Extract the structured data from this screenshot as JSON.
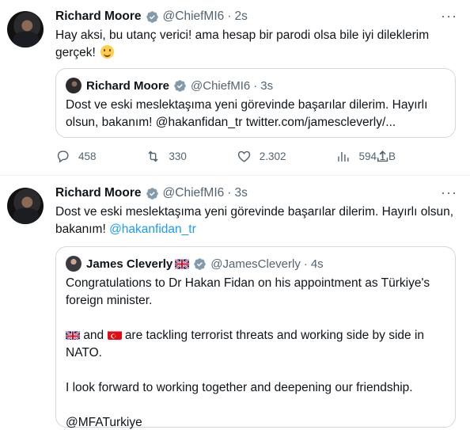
{
  "tweet1": {
    "author_name": "Richard Moore",
    "handle": "@ChiefMI6",
    "separator": "·",
    "time": "2s",
    "text": "Hay aksi, bu utanç verici! ama hesap bir parodi olsa bile iyi dileklerim gerçek!",
    "emoji_icon": "smiling-face-icon",
    "quote": {
      "author_name": "Richard Moore",
      "handle": "@ChiefMI6",
      "separator": "·",
      "time": "3s",
      "text": "Dost ve eski meslektaşıma yeni görevinde başarılar dilerim.  Hayırlı olsun, bakanım! @hakanfidan_tr twitter.com/jamescleverly/..."
    },
    "actions": {
      "replies": "458",
      "retweets": "330",
      "likes": "2.302",
      "views": "594,1 B"
    }
  },
  "tweet2": {
    "author_name": "Richard Moore",
    "handle": "@ChiefMI6",
    "separator": "·",
    "time": "3s",
    "text_before": "Dost ve eski meslektaşıma yeni görevinde başarılar dilerim.  Hayırlı olsun, bakanım! ",
    "mention": "@hakanfidan_tr",
    "quote": {
      "author_name": "James Cleverly",
      "handle": "@JamesCleverly",
      "separator": "·",
      "time": "4s",
      "para1": "Congratulations to Dr Hakan Fidan on his appointment as Türkiye's foreign minister.",
      "para2_and": "and",
      "para2_rest": "are tackling terrorist threats and working side by side in NATO.",
      "para3": "I look forward to working together and deepening our friendship.",
      "para4": "@MFATurkiye"
    }
  },
  "colors": {
    "accent": "#1d9bf0",
    "muted": "#536471",
    "border": "#cfd9de",
    "text": "#0f1419"
  }
}
